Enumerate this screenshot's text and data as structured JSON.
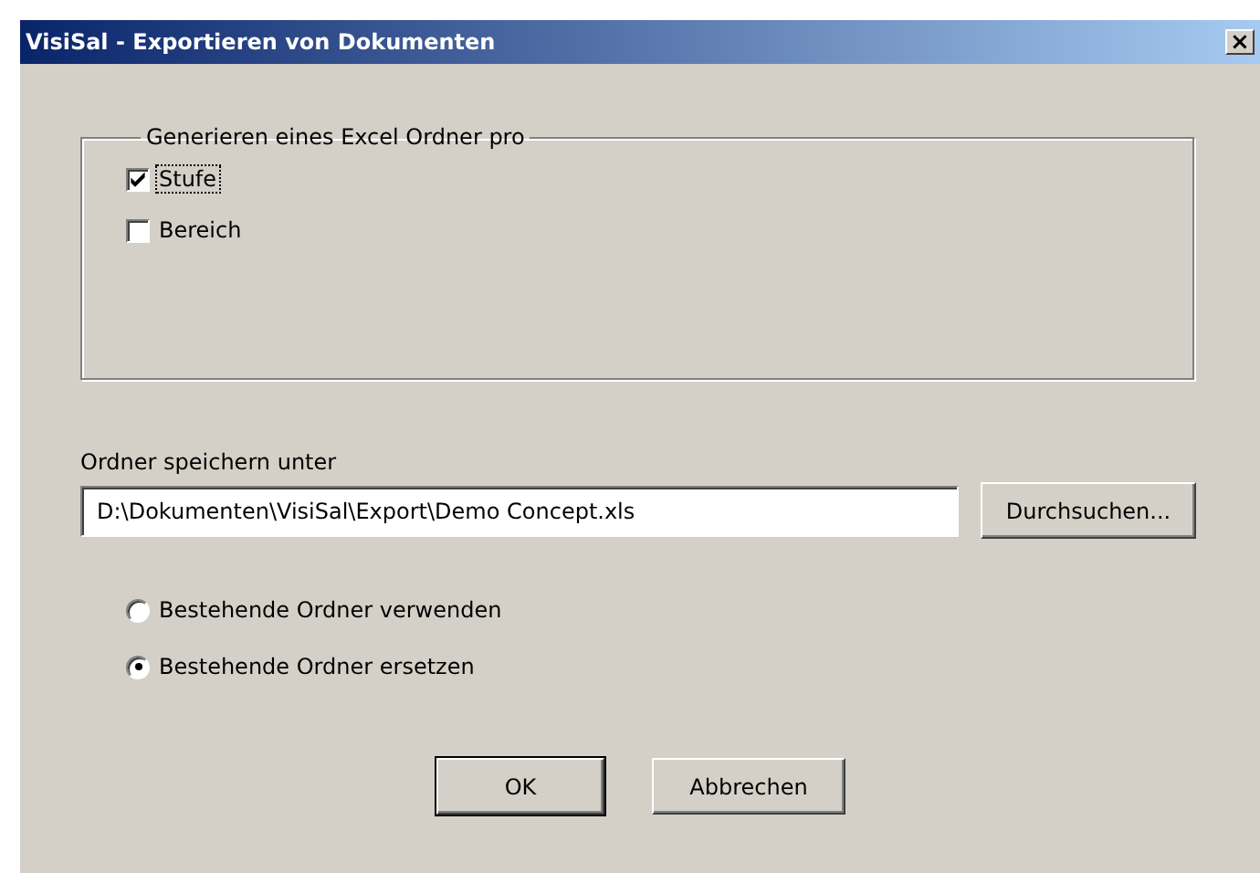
{
  "window": {
    "title": "VisiSal - Exportieren von Dokumenten",
    "close_icon": "×"
  },
  "group": {
    "legend": "Generieren eines Excel Ordner pro",
    "options": [
      {
        "label": "Stufe",
        "checked": true,
        "focused": true
      },
      {
        "label": "Bereich",
        "checked": false,
        "focused": false
      }
    ]
  },
  "path": {
    "label": "Ordner speichern unter",
    "value": "D:\\Dokumenten\\VisiSal\\Export\\Demo Concept.xls",
    "browse": "Durchsuchen..."
  },
  "mode": [
    {
      "label": "Bestehende Ordner verwenden",
      "selected": false
    },
    {
      "label": "Bestehende Ordner ersetzen",
      "selected": true
    }
  ],
  "buttons": [
    {
      "label": "OK",
      "default": true
    },
    {
      "label": "Abbrechen",
      "default": false
    }
  ]
}
